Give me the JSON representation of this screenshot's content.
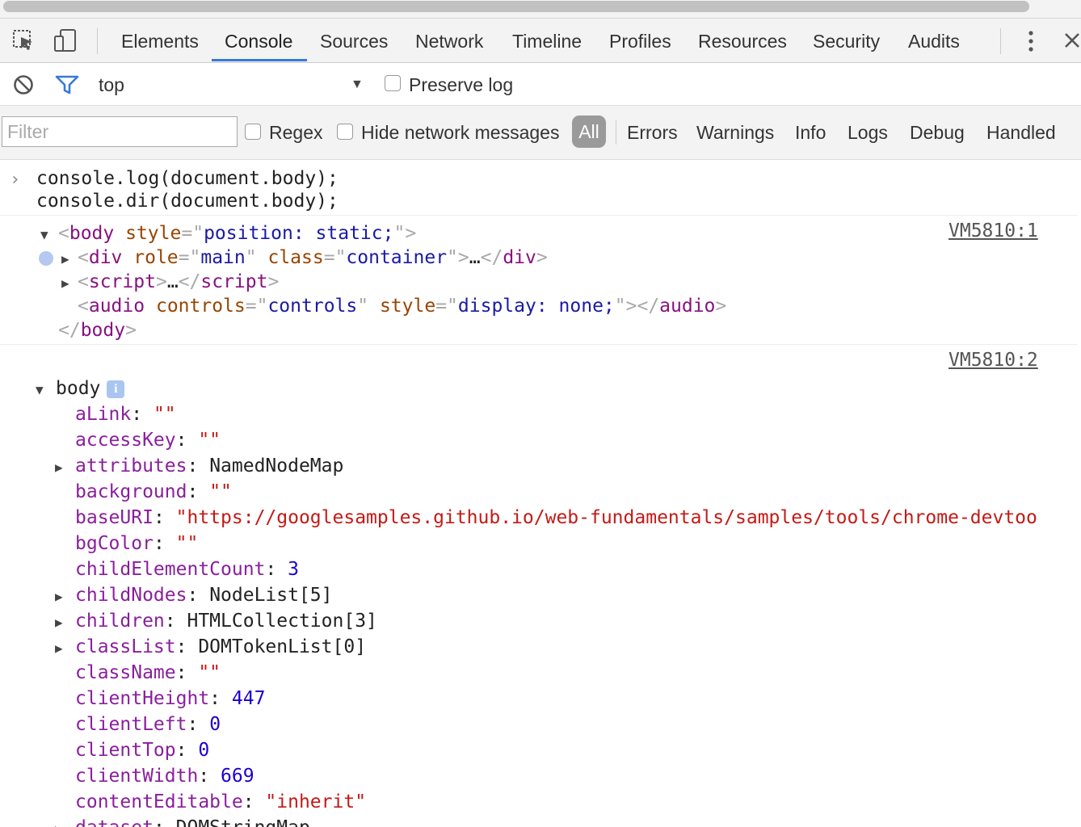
{
  "tabs": [
    "Elements",
    "Console",
    "Sources",
    "Network",
    "Timeline",
    "Profiles",
    "Resources",
    "Security",
    "Audits"
  ],
  "active_tab": "Console",
  "toolbar": {
    "context": "top",
    "preserve_log": "Preserve log"
  },
  "filter": {
    "placeholder": "Filter",
    "regex": "Regex",
    "hide_network": "Hide network messages",
    "levels": [
      "All",
      "Errors",
      "Warnings",
      "Info",
      "Logs",
      "Debug",
      "Handled"
    ]
  },
  "console": {
    "command_lines": [
      "console.log(document.body);",
      "console.dir(document.body);"
    ],
    "source_links": [
      "VM5810:1",
      "VM5810:2"
    ],
    "log_body_open": {
      "tag": "body",
      "attr": "style",
      "val": "position: static;"
    },
    "log_div": {
      "tag": "div",
      "attr1": "role",
      "val1": "main",
      "attr2": "class",
      "val2": "container",
      "ellipsis": "…"
    },
    "log_script": {
      "tag": "script",
      "ellipsis": "…"
    },
    "log_audio": {
      "tag": "audio",
      "attr1": "controls",
      "val1": "controls",
      "attr2": "style",
      "val2": "display: none;"
    },
    "log_body_close": "body",
    "dir_root": "body",
    "info_badge": "i",
    "properties": [
      {
        "key": "aLink",
        "value": "\"\"",
        "kind": "str",
        "expandable": false
      },
      {
        "key": "accessKey",
        "value": "\"\"",
        "kind": "str",
        "expandable": false
      },
      {
        "key": "attributes",
        "value": "NamedNodeMap",
        "kind": "obj",
        "expandable": true
      },
      {
        "key": "background",
        "value": "\"\"",
        "kind": "str",
        "expandable": false
      },
      {
        "key": "baseURI",
        "value": "\"https://googlesamples.github.io/web-fundamentals/samples/tools/chrome-devtoo",
        "kind": "str",
        "expandable": false
      },
      {
        "key": "bgColor",
        "value": "\"\"",
        "kind": "str",
        "expandable": false
      },
      {
        "key": "childElementCount",
        "value": "3",
        "kind": "num",
        "expandable": false
      },
      {
        "key": "childNodes",
        "value": "NodeList[5]",
        "kind": "obj",
        "expandable": true
      },
      {
        "key": "children",
        "value": "HTMLCollection[3]",
        "kind": "obj",
        "expandable": true
      },
      {
        "key": "classList",
        "value": "DOMTokenList[0]",
        "kind": "obj",
        "expandable": true
      },
      {
        "key": "className",
        "value": "\"\"",
        "kind": "str",
        "expandable": false
      },
      {
        "key": "clientHeight",
        "value": "447",
        "kind": "num",
        "expandable": false
      },
      {
        "key": "clientLeft",
        "value": "0",
        "kind": "num",
        "expandable": false
      },
      {
        "key": "clientTop",
        "value": "0",
        "kind": "num",
        "expandable": false
      },
      {
        "key": "clientWidth",
        "value": "669",
        "kind": "num",
        "expandable": false
      },
      {
        "key": "contentEditable",
        "value": "\"inherit\"",
        "kind": "str",
        "expandable": false
      },
      {
        "key": "dataset",
        "value": "DOMStringMap",
        "kind": "obj",
        "expandable": true
      }
    ]
  },
  "colors": {
    "accent": "#3879d9",
    "tag": "#881280",
    "attr": "#994500",
    "attr_value": "#1a1aa6",
    "prop_key": "#8a1e9e",
    "string": "#c41a16",
    "number": "#1c00cf"
  }
}
